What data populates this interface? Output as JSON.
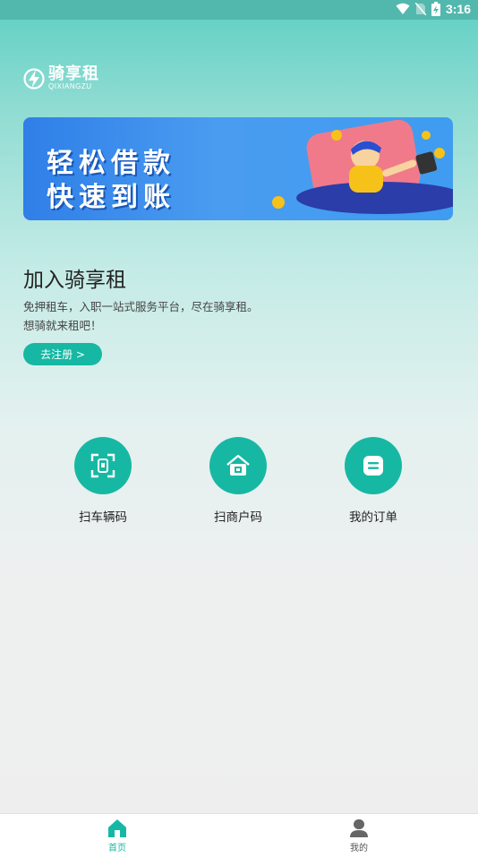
{
  "status_bar": {
    "time": "3:16",
    "icons": [
      "wifi-icon",
      "no-sim-icon",
      "battery-charging-icon"
    ]
  },
  "logo": {
    "title": "骑享租",
    "subtitle": "QIXIANGZU",
    "icon": "lightning-logo-icon"
  },
  "banner": {
    "line1": "轻松借款",
    "line2": "快速到账"
  },
  "join": {
    "title": "加入骑享租",
    "desc_line1": "免押租车，入职一站式服务平台，尽在骑享租。",
    "desc_line2": "想骑就来租吧！",
    "register_label": "去注册 >"
  },
  "actions": [
    {
      "label": "扫车辆码",
      "icon": "scan-vehicle-icon"
    },
    {
      "label": "扫商户码",
      "icon": "scan-merchant-icon"
    },
    {
      "label": "我的订单",
      "icon": "order-icon"
    }
  ],
  "tabbar": {
    "home_label": "首页",
    "mine_label": "我的",
    "active_color": "#17b8a3"
  },
  "colors": {
    "accent": "#17b8a3",
    "status_bar": "#52b8ad"
  }
}
